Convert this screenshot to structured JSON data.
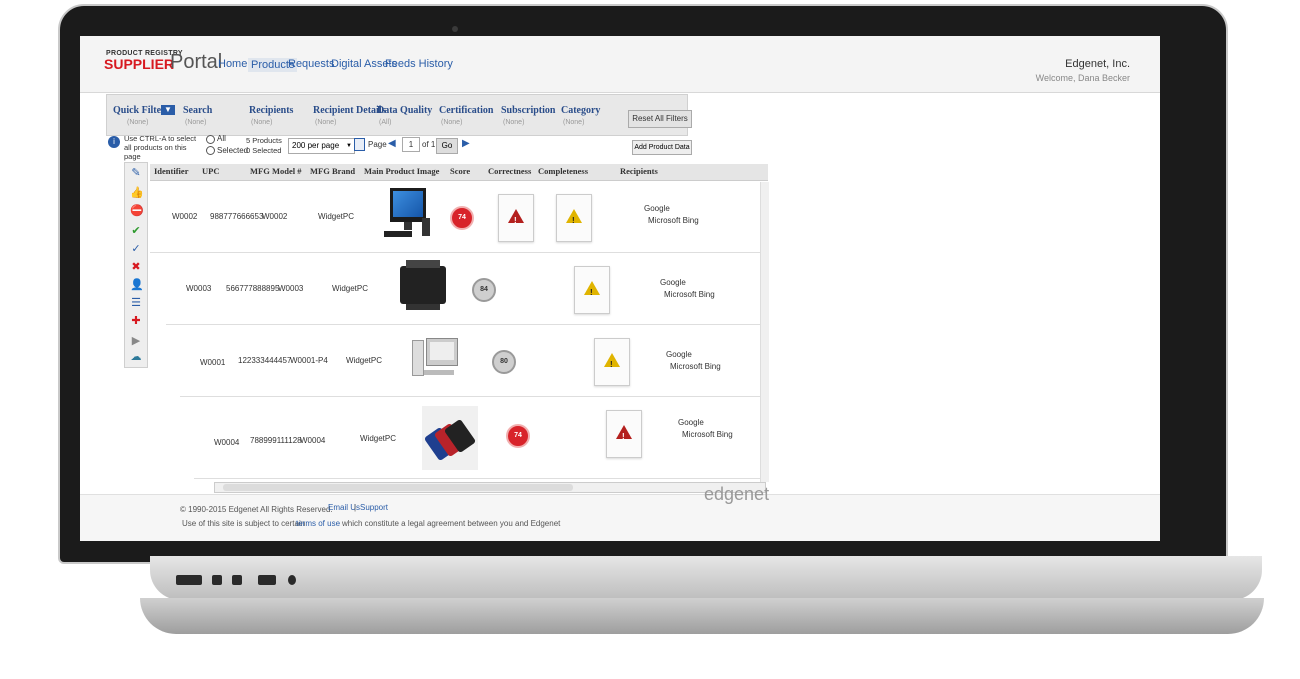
{
  "app": {
    "logo_small": "PRODUCT REGISTRY",
    "logo_supplier": "SUPPLIER",
    "logo_portal": "Portal",
    "company": "Edgenet, Inc.",
    "welcome": "Welcome, Dana Becker"
  },
  "nav": [
    {
      "label": "Home"
    },
    {
      "label": "Products"
    },
    {
      "label": "Requests"
    },
    {
      "label": "Digital Assets"
    },
    {
      "label": "Feeds History"
    }
  ],
  "filters": {
    "quick_filter_label": "Quick Filter:",
    "items": [
      {
        "label": "Search",
        "value": "(None)"
      },
      {
        "label": "Recipients",
        "value": "(None)"
      },
      {
        "label": "Recipient Details",
        "value": "(None)"
      },
      {
        "label": "Data Quality",
        "value": "(All)"
      },
      {
        "label": "Certification",
        "value": "(None)"
      },
      {
        "label": "Subscription",
        "value": "(None)"
      },
      {
        "label": "Category",
        "value": "(None)"
      }
    ],
    "quick_filter_value": "(None)",
    "reset_label": "Reset All Filters"
  },
  "toolbar": {
    "hint": "Use CTRL-A to select all products on this page",
    "radio_all": "All",
    "radio_selected": "Selected",
    "products_count": "5 Products",
    "selected_count": "0 Selected",
    "per_page": "200 per page",
    "page_label": "Page",
    "page_value": "1",
    "of_label": "of 1",
    "go_label": "Go",
    "add_product_data": "Add Product Data"
  },
  "table": {
    "headers": [
      "Identifier",
      "UPC",
      "MFG Model #",
      "MFG Brand",
      "Main Product Image",
      "Score",
      "Correctness",
      "Completeness",
      "Recipients"
    ],
    "rows": [
      {
        "id": "W0002",
        "upc": "988777666653",
        "model": "W0002",
        "brand": "WidgetPC",
        "score": "74",
        "score_color": "red",
        "correctness": "red",
        "completeness": "yellow",
        "recipients": [
          "Google",
          "Microsoft Bing"
        ]
      },
      {
        "id": "W0003",
        "upc": "566777888895",
        "model": "W0003",
        "brand": "WidgetPC",
        "score": "84",
        "score_color": "grey",
        "correctness": "",
        "completeness": "yellow",
        "recipients": [
          "Google",
          "Microsoft Bing"
        ]
      },
      {
        "id": "W0001",
        "upc": "122333444457",
        "model": "W0001-P4",
        "brand": "WidgetPC",
        "score": "80",
        "score_color": "grey",
        "correctness": "",
        "completeness": "yellow",
        "recipients": [
          "Google",
          "Microsoft Bing"
        ]
      },
      {
        "id": "W0004",
        "upc": "788999111128",
        "model": "W0004",
        "brand": "WidgetPC",
        "score": "74",
        "score_color": "red",
        "correctness": "",
        "completeness": "red",
        "recipients": [
          "Google",
          "Microsoft Bing"
        ]
      }
    ]
  },
  "footer": {
    "copyright": "© 1990-2015 Edgenet All Rights Reserved.",
    "email": "Email Us",
    "support": "Support",
    "terms_prefix": "Use of this site is subject to certain",
    "terms_link": "terms of use",
    "terms_suffix": "which constitute a legal agreement between you and Edgenet",
    "brand": "edgenet"
  },
  "colors": {
    "accent": "#d71920",
    "link": "#2a5da8"
  }
}
